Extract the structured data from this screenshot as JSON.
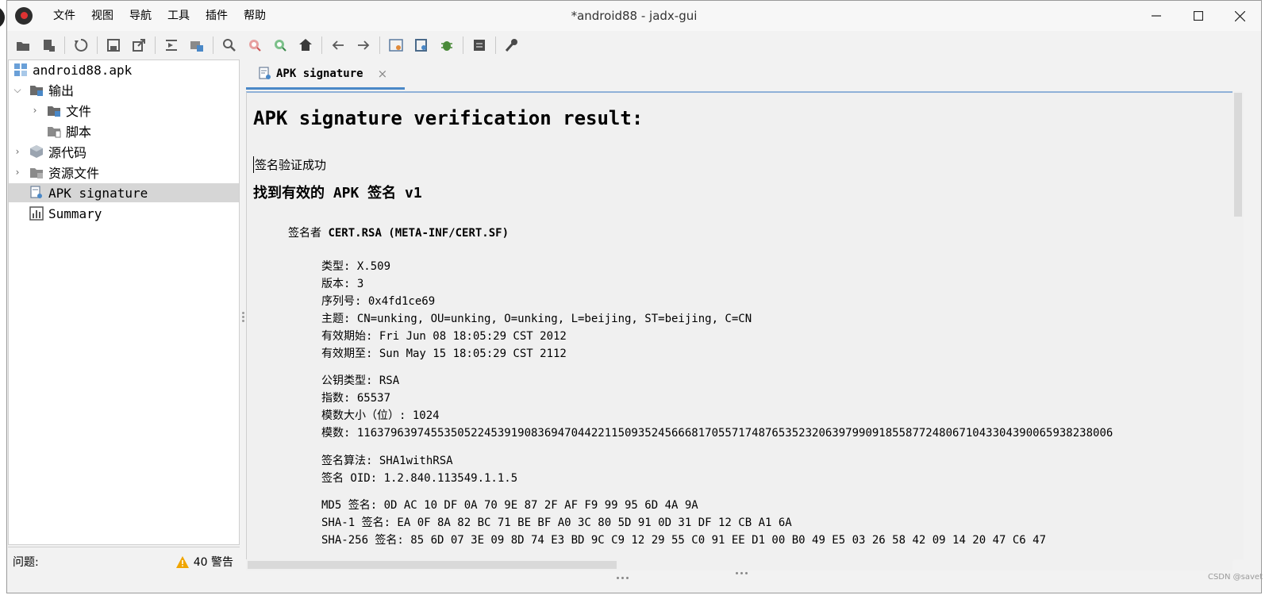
{
  "window": {
    "title": "*android88 - jadx-gui",
    "controls": [
      "—",
      "☐",
      "✕"
    ]
  },
  "menu": [
    "文件",
    "视图",
    "导航",
    "工具",
    "插件",
    "帮助"
  ],
  "toolbar": {
    "groups": [
      [
        "open-file-icon",
        "add-files-icon"
      ],
      [
        "sync-icon"
      ],
      [
        "save-icon",
        "export-icon"
      ],
      [
        "sync-with-editor-icon",
        "flatten-packages-icon"
      ],
      [
        "search-icon",
        "find-class-icon",
        "find-usage-icon",
        "home-icon"
      ],
      [
        "back-icon",
        "forward-icon"
      ],
      [
        "deobfuscation-icon",
        "quick-tabs-icon",
        "debug-icon"
      ],
      [
        "log-viewer-icon"
      ],
      [
        "preferences-icon"
      ]
    ]
  },
  "tree": {
    "root": "android88.apk",
    "items": [
      {
        "label": "输出",
        "indent": 1,
        "chevron": "⌵",
        "icon": "folder-output-icon"
      },
      {
        "label": "文件",
        "indent": 2,
        "chevron": "›",
        "icon": "folder-files-icon"
      },
      {
        "label": "脚本",
        "indent": 2,
        "chevron": "",
        "icon": "folder-scripts-icon"
      },
      {
        "label": "源代码",
        "indent": 1,
        "chevron": "›",
        "icon": "package-icon"
      },
      {
        "label": "资源文件",
        "indent": 1,
        "chevron": "›",
        "icon": "resources-folder-icon"
      },
      {
        "label": "APK signature",
        "indent": 1,
        "chevron": "",
        "icon": "certificate-icon",
        "selected": true,
        "mono": true
      },
      {
        "label": "Summary",
        "indent": 1,
        "chevron": "",
        "icon": "chart-icon",
        "mono": true
      }
    ]
  },
  "status": {
    "label": "问题:",
    "warnings": "40 警告"
  },
  "tab": {
    "label": "APK signature",
    "close": "×"
  },
  "content": {
    "heading": "APK signature verification result:",
    "success": "签名验证成功",
    "found": "找到有效的 APK 签名 v1",
    "signer_prefix": "签名者 ",
    "signer": "CERT.RSA (META-INF/CERT.SF)",
    "block1": [
      "类型: X.509",
      "版本: 3",
      "序列号: 0x4fd1ce69",
      "主题: CN=unking, OU=unking, O=unking, L=beijing, ST=beijing, C=CN",
      "有效期始: Fri Jun 08 18:05:29 CST 2012",
      "有效期至: Sun May 15 18:05:29 CST 2112"
    ],
    "block2": [
      "公钥类型: RSA",
      "指数: 65537",
      "模数大小（位）: 1024",
      "模数: 11637963974553505224539190836947044221150935245666817055717487653523206397990918558772480671043304390065938238006"
    ],
    "block3": [
      "签名算法: SHA1withRSA",
      "签名 OID: 1.2.840.113549.1.1.5"
    ],
    "block4": [
      "MD5 签名: 0D AC 10 DF 0A 70 9E 87 2F AF F9 99 95 6D 4A 9A",
      "SHA-1 签名: EA 0F 8A 82 BC 71 BE BF A0 3C 80 5D 91 0D 31 DF 12 CB A1 6A",
      "SHA-256 签名: 85 6D 07 3E 09 8D 74 E3 BD 9C C9 12 29 55 C0 91 EE D1 00 B0 49 E5 03 26 58 42 09 14 20 47 C6 47"
    ]
  },
  "watermark": "CSDN @savet"
}
